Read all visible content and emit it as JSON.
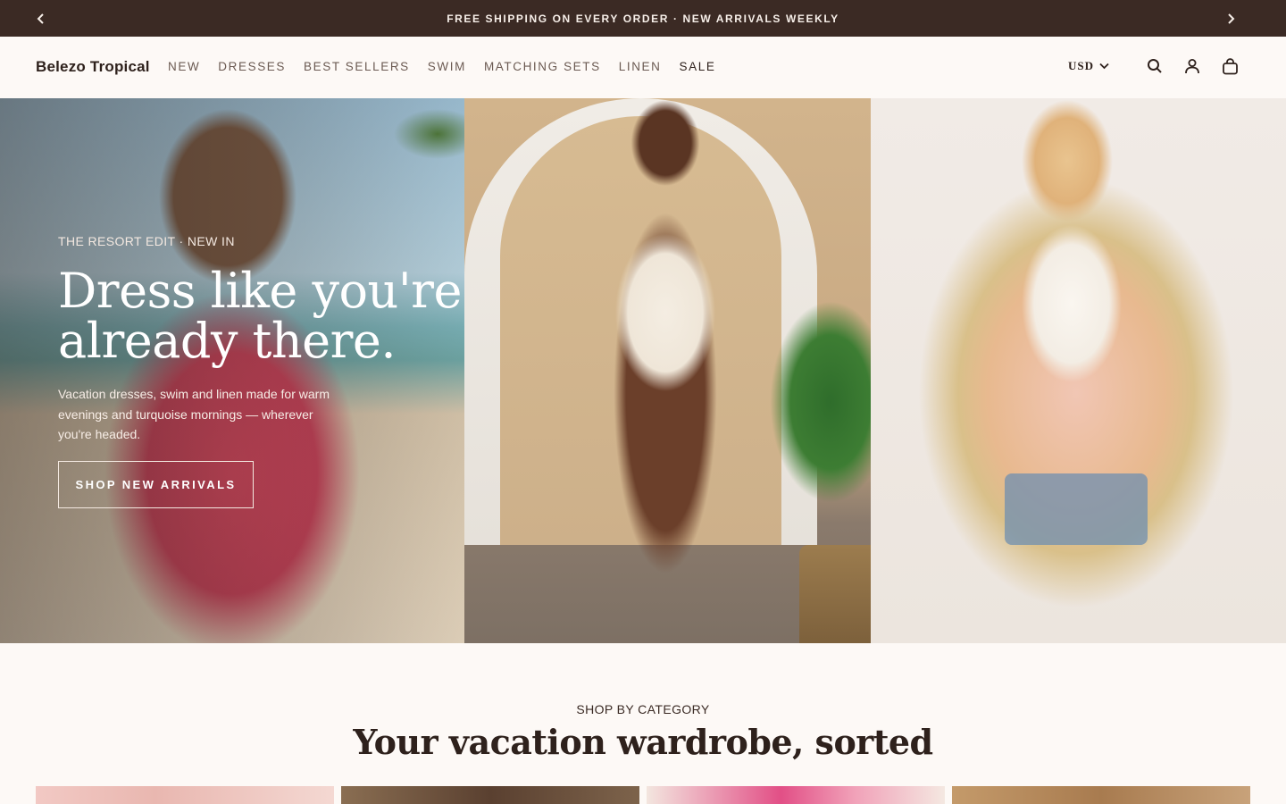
{
  "announcement": {
    "text": "FREE SHIPPING ON EVERY ORDER · NEW ARRIVALS WEEKLY",
    "prev_icon": "chevron-left-icon",
    "next_icon": "chevron-right-icon"
  },
  "header": {
    "logo": "Belezo Tropical",
    "nav": [
      "NEW",
      "DRESSES",
      "BEST SELLERS",
      "SWIM",
      "MATCHING SETS",
      "LINEN",
      "SALE"
    ],
    "currency": "USD",
    "icons": [
      "search-icon",
      "account-icon",
      "cart-icon"
    ]
  },
  "hero": {
    "eyebrow": "THE RESORT EDIT · NEW IN",
    "title_line1": "Dress like you're",
    "title_line2": "already there.",
    "subtitle": "Vacation dresses, swim and linen made for warm evenings and turquoise mornings — wherever you're headed.",
    "cta": "SHOP NEW ARRIVALS"
  },
  "categories": {
    "eyebrow": "SHOP BY CATEGORY",
    "title": "Your vacation wardrobe, sorted"
  },
  "colors": {
    "announcement_bg": "#3b2a24",
    "page_bg": "#fdf9f6",
    "text_dark": "#2e211c",
    "nav_text": "#6b5a52"
  }
}
